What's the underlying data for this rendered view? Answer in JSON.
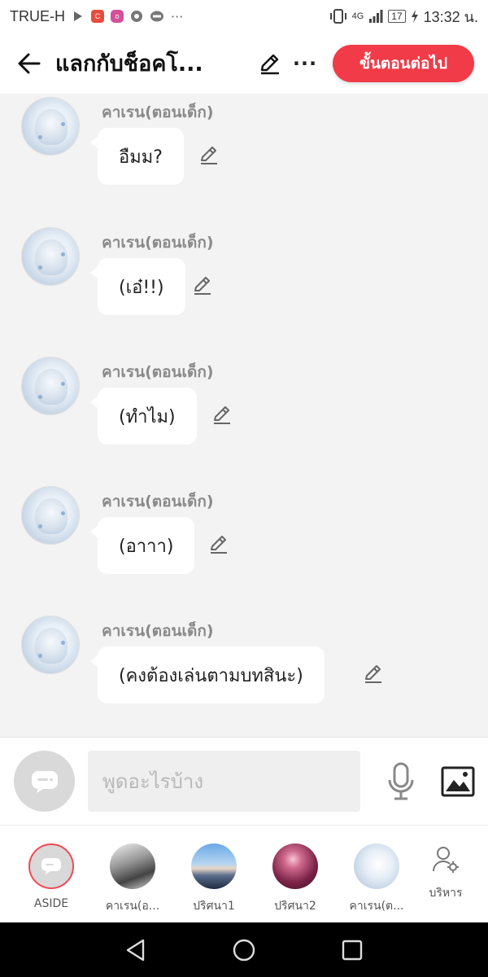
{
  "status_bar": {
    "carrier": "TRUE-H",
    "left_icons": [
      "play-store-icon",
      "c-app-icon",
      "instagram-style-icon",
      "chrome-icon",
      "line-icon",
      "more-dots-icon"
    ],
    "network": "4G",
    "battery": "17",
    "time": "13:32 น."
  },
  "header": {
    "title": "แลกกับช็อคโ...",
    "next_button": "ขั้นตอนต่อไป",
    "more_label": "···"
  },
  "messages": [
    {
      "sender": "คาเรน(ตอนเด็ก)",
      "text": "อืมม?"
    },
    {
      "sender": "คาเรน(ตอนเด็ก)",
      "text": "(เอ๋!!)"
    },
    {
      "sender": "คาเรน(ตอนเด็ก)",
      "text": "(ทำไม)"
    },
    {
      "sender": "คาเรน(ตอนเด็ก)",
      "text": "(อาาา)"
    },
    {
      "sender": "คาเรน(ตอนเด็ก)",
      "text": "(คงต้องเล่นตามบทสินะ)"
    }
  ],
  "input": {
    "placeholder": "พูดอะไรบ้าง",
    "value": ""
  },
  "characters": [
    {
      "label": "ASIDE",
      "avatar": "aside-icon"
    },
    {
      "label": "คาเรน(อ...",
      "avatar": "karen-avatar"
    },
    {
      "label": "ปริศนา1",
      "avatar": "mountain-avatar"
    },
    {
      "label": "ปริศนา2",
      "avatar": "pink-moon-avatar"
    },
    {
      "label": "คาเรน(ต...",
      "avatar": "karen-child-avatar"
    }
  ],
  "manage": {
    "label": "บริหาร"
  },
  "colors": {
    "accent": "#f23b48",
    "chat_background": "#f3f3f3",
    "sender_text": "#8a8a8a"
  }
}
